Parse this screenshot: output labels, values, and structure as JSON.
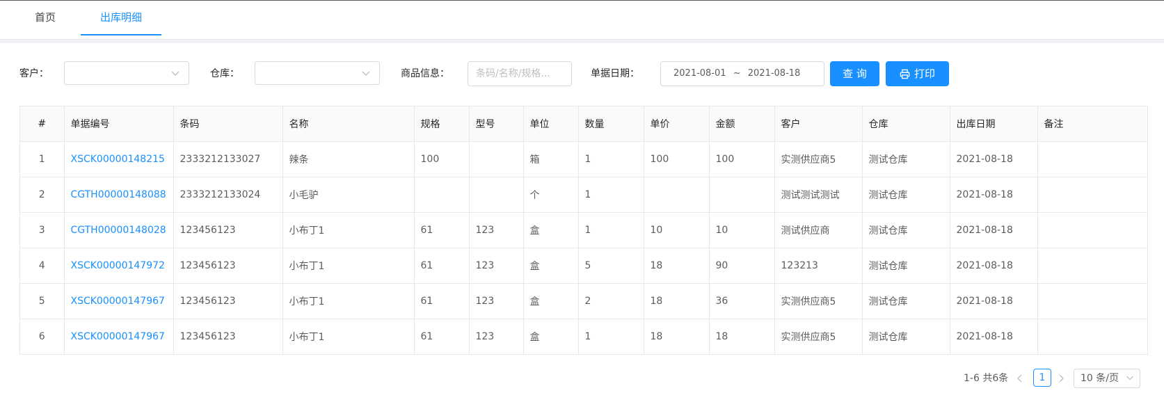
{
  "tabs": [
    {
      "label": "首页",
      "active": false
    },
    {
      "label": "出库明细",
      "active": true
    }
  ],
  "filters": {
    "customer_label": "客户：",
    "customer_value": "",
    "warehouse_label": "仓库：",
    "warehouse_value": "",
    "goods_label": "商品信息：",
    "goods_placeholder": "条码/名称/规格...",
    "date_label": "单据日期：",
    "date_start": "2021-08-01",
    "date_sep": "~",
    "date_end": "2021-08-18",
    "search_button": "查 询",
    "print_button": "打印"
  },
  "table": {
    "columns": [
      "#",
      "单据编号",
      "条码",
      "名称",
      "规格",
      "型号",
      "单位",
      "数量",
      "单价",
      "金额",
      "客户",
      "仓库",
      "出库日期",
      "备注"
    ],
    "rows": [
      [
        "1",
        "XSCK00000148215",
        "2333212133027",
        "辣条",
        "100",
        "",
        "箱",
        "1",
        "100",
        "100",
        "实测供应商5",
        "测试仓库",
        "2021-08-18",
        ""
      ],
      [
        "2",
        "CGTH00000148088",
        "2333212133024",
        "小毛驴",
        "",
        "",
        "个",
        "1",
        "",
        "",
        "测试测试测试",
        "测试仓库",
        "2021-08-18",
        ""
      ],
      [
        "3",
        "CGTH00000148028",
        "123456123",
        "小布丁1",
        "61",
        "123",
        "盒",
        "1",
        "10",
        "10",
        "测试供应商",
        "测试仓库",
        "2021-08-18",
        ""
      ],
      [
        "4",
        "XSCK00000147972",
        "123456123",
        "小布丁1",
        "61",
        "123",
        "盒",
        "5",
        "18",
        "90",
        "123213",
        "测试仓库",
        "2021-08-18",
        ""
      ],
      [
        "5",
        "XSCK00000147967",
        "123456123",
        "小布丁1",
        "61",
        "123",
        "盒",
        "2",
        "18",
        "36",
        "实测供应商5",
        "测试仓库",
        "2021-08-18",
        ""
      ],
      [
        "6",
        "XSCK00000147967",
        "123456123",
        "小布丁1",
        "61",
        "123",
        "盒",
        "1",
        "18",
        "18",
        "实测供应商5",
        "测试仓库",
        "2021-08-18",
        ""
      ]
    ]
  },
  "pagination": {
    "total_text": "1-6 共6条",
    "current_page": "1",
    "page_size": "10 条/页"
  },
  "colors": {
    "primary": "#1890ff",
    "border": "#e8e8e8",
    "header_bg": "#fafafa"
  },
  "icons": {
    "select_arrow": "chevron-down-icon",
    "print": "printer-icon",
    "prev": "chevron-left-icon",
    "next": "chevron-right-icon"
  }
}
